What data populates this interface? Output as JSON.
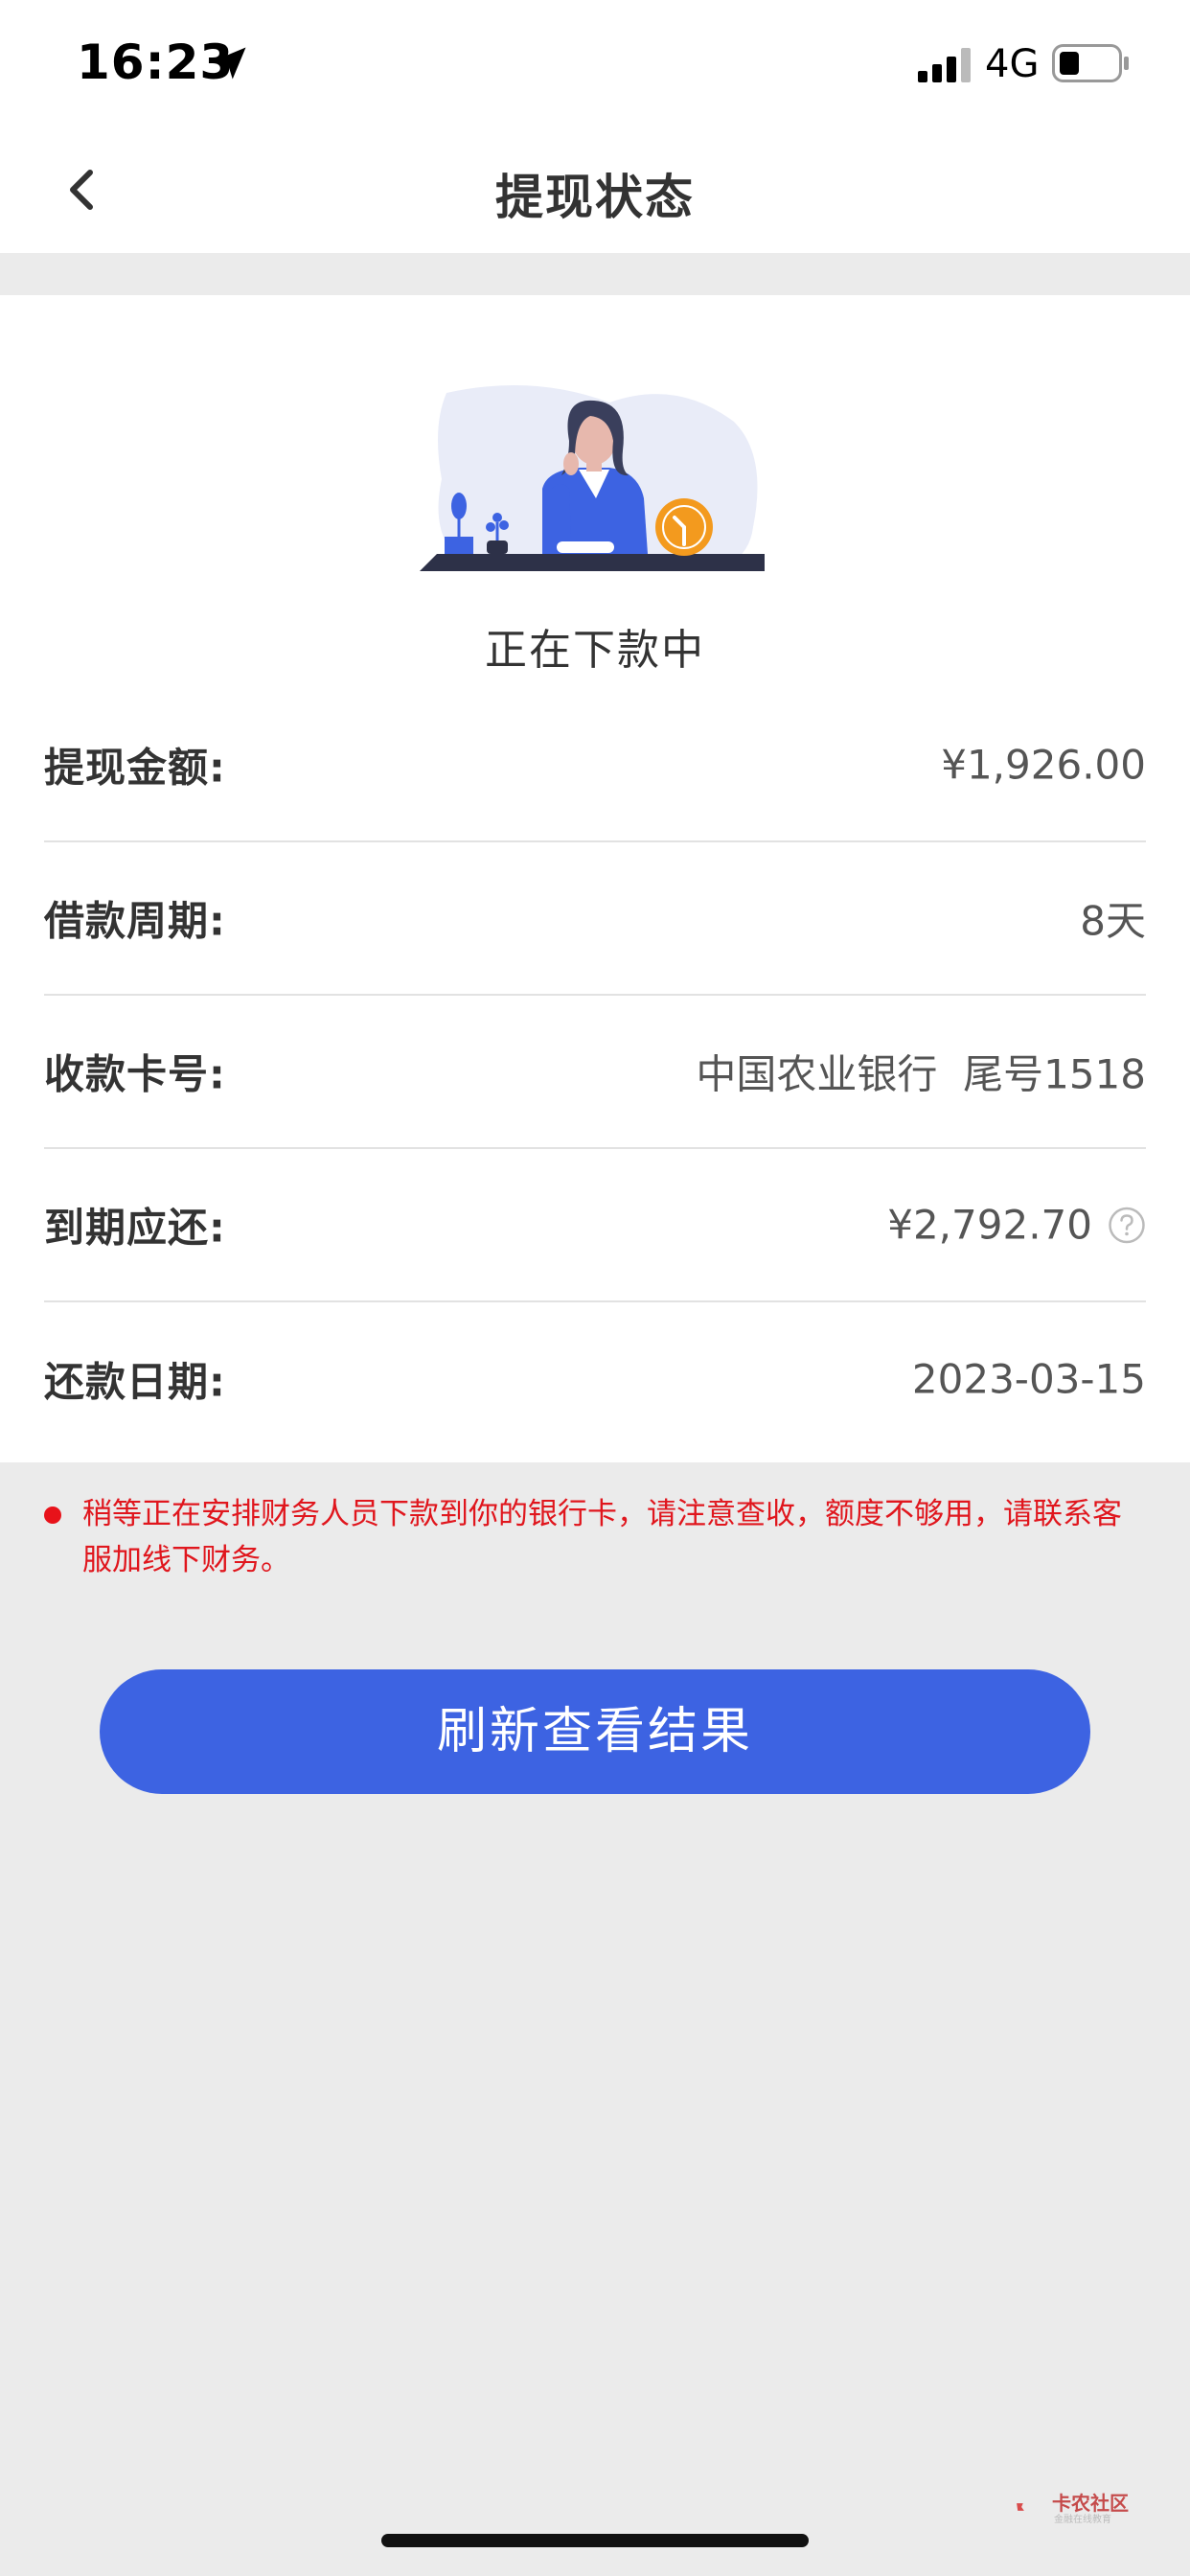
{
  "status_bar": {
    "time": "16:23",
    "network": "4G"
  },
  "nav": {
    "title": "提现状态"
  },
  "status": {
    "title": "正在下款中"
  },
  "rows": [
    {
      "label": "提现金额:",
      "value": "¥1,926.00"
    },
    {
      "label": "借款周期:",
      "value": "8天"
    },
    {
      "label": "收款卡号:",
      "value": "中国农业银行  尾号1518"
    },
    {
      "label": "到期应还:",
      "value": "¥2,792.70"
    },
    {
      "label": "还款日期:",
      "value": "2023-03-15"
    }
  ],
  "notice": {
    "text": "稍等正在安排财务人员下款到你的银行卡，请注意查收，额度不够用，请联系客服加线下财务。"
  },
  "button": {
    "label": "刷新查看结果"
  },
  "watermark": {
    "title": "卡农社区",
    "subtitle": "金融在线教育"
  },
  "colors": {
    "accent": "#3d63e2",
    "notice": "#e0161d"
  }
}
